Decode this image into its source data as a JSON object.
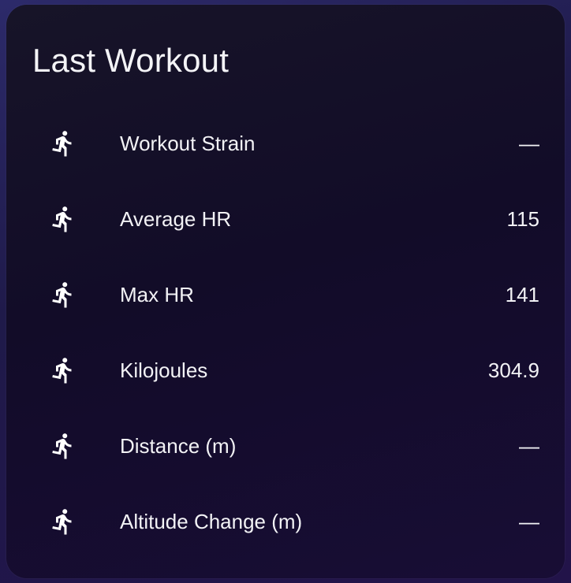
{
  "card": {
    "title": "Last Workout",
    "rows": [
      {
        "icon": "run-icon",
        "label": "Workout Strain",
        "value": "—"
      },
      {
        "icon": "run-icon",
        "label": "Average HR",
        "value": "115"
      },
      {
        "icon": "run-icon",
        "label": "Max HR",
        "value": "141"
      },
      {
        "icon": "run-icon",
        "label": "Kilojoules",
        "value": "304.9"
      },
      {
        "icon": "run-icon",
        "label": "Distance (m)",
        "value": "—"
      },
      {
        "icon": "run-icon",
        "label": "Altitude Change (m)",
        "value": "—"
      }
    ]
  },
  "colors": {
    "text": "#f2f2f5",
    "card_background": "#140e2c",
    "page_background": "#2a2560"
  }
}
